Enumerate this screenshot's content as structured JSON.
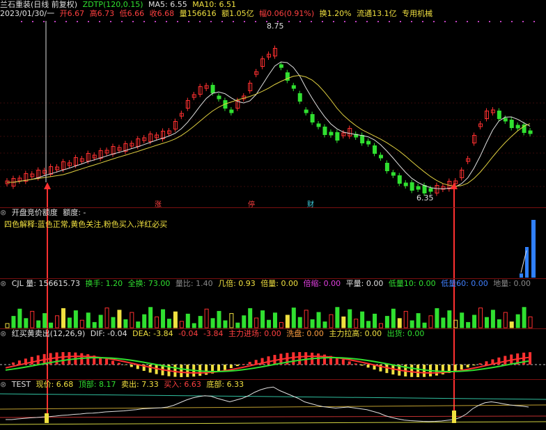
{
  "header": {
    "stock": "兰石重装(日线 前复权)",
    "indicator": "ZDTP(120,0.15)",
    "ma5": "MA5: 6.55",
    "ma10": "MA10: 6.51",
    "date": "2023/01/30/一",
    "open": "开6.67",
    "high": "高6.73",
    "low": "低6.66",
    "close": "收6.68",
    "volume": "量156616",
    "amount": "额1.05亿",
    "change": "幅0.06(0.91%)",
    "turnover": "换1.20%",
    "float_cap": "流通13.1亿",
    "sector": "专用机械"
  },
  "price_labels": {
    "high": "8.75",
    "low": "6.35"
  },
  "markers": {
    "m1": "涨",
    "m2": "停",
    "m3": "财"
  },
  "panel2": {
    "title": "开盘竞价额度",
    "field": "额度: -",
    "note": "四色解释:蓝色正常,黄色关注,粉色买入,洋红必买"
  },
  "panel3": {
    "name": "CJL 量: 156615.73",
    "huanshou": "换手: 1.20",
    "quanhuan": "全换: 73.00",
    "liangbi": "量比: 1.40",
    "jibei": "几倍: 0.93",
    "beiliang": "倍量: 0.00",
    "beisuo": "倍缩: 0.00",
    "pingliang": "平量: 0.00",
    "diliang10": "低量10: 0.00",
    "diliang60": "低量60: 0.00",
    "diliang": "地量: 0.00"
  },
  "panel4": {
    "name": "红买黄卖出(12,26,9)",
    "dif": "DIF: -0.04",
    "dea": "DEA: -3.84",
    "v1": "-0.04",
    "v2": "-3.84",
    "zljc": "主力进场: 0.00",
    "xq": "洗盘: 0.00",
    "zllg": "主力拉高: 0.00",
    "chuhuo": "出货: 0.00"
  },
  "panel5": {
    "name": "TEST",
    "xianjia": "现价: 6.68",
    "dingbu": "顶部: 8.17",
    "maichu": "卖出: 7.33",
    "mairu": "买入: 6.63",
    "dibu": "底部: 6.33"
  },
  "colors": {
    "up": "#ff3030",
    "down": "#30e030",
    "bg": "#000000",
    "sep": "#7a1010"
  }
}
